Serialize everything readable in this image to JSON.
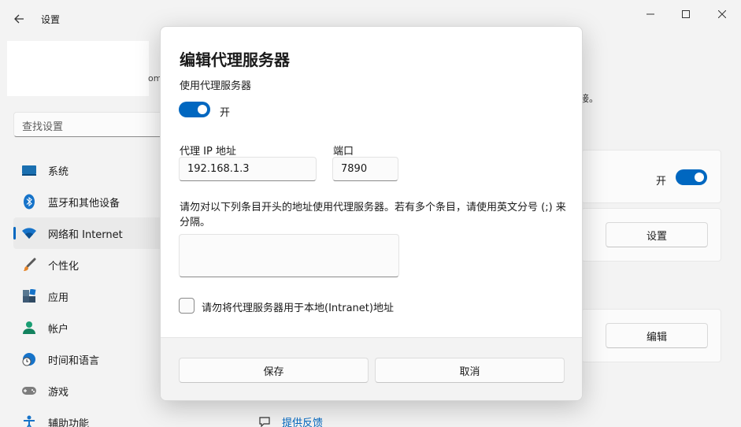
{
  "window": {
    "title": "设置"
  },
  "background": {
    "partial_om": "om",
    "partial_text": "接。"
  },
  "sidebar": {
    "search_placeholder": "查找设置",
    "items": [
      {
        "label": "系统",
        "icon": "system-icon",
        "active": false
      },
      {
        "label": "蓝牙和其他设备",
        "icon": "bluetooth-icon",
        "active": false
      },
      {
        "label": "网络和 Internet",
        "icon": "wifi-icon",
        "active": true
      },
      {
        "label": "个性化",
        "icon": "brush-icon",
        "active": false
      },
      {
        "label": "应用",
        "icon": "apps-icon",
        "active": false
      },
      {
        "label": "帐户",
        "icon": "account-icon",
        "active": false
      },
      {
        "label": "时间和语言",
        "icon": "time-language-icon",
        "active": false
      },
      {
        "label": "游戏",
        "icon": "gamepad-icon",
        "active": false
      },
      {
        "label": "辅助功能",
        "icon": "accessibility-icon",
        "active": false
      }
    ]
  },
  "main": {
    "toggle_label": "开",
    "settings_button": "设置",
    "edit_button": "编辑",
    "feedback_link": "提供反馈"
  },
  "dialog": {
    "title": "编辑代理服务器",
    "use_proxy_label": "使用代理服务器",
    "toggle_state": "开",
    "ip_label": "代理 IP 地址",
    "ip_value": "192.168.1.3",
    "port_label": "端口",
    "port_value": "7890",
    "exceptions_description": "请勿对以下列条目开头的地址使用代理服务器。若有多个条目，请使用英文分号 (;) 来分隔。",
    "exceptions_value": "",
    "local_checkbox_label": "请勿将代理服务器用于本地(Intranet)地址",
    "save_button": "保存",
    "cancel_button": "取消"
  },
  "colors": {
    "accent": "#0067c0",
    "background": "#f3f3f3"
  }
}
